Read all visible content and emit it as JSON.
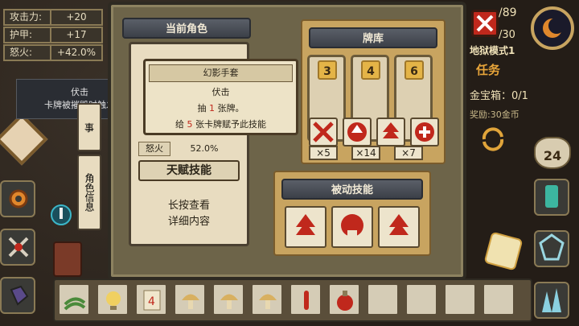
{
  "stats": [
    {
      "label": "攻击力:",
      "value": "+20"
    },
    {
      "label": "护甲:",
      "value": "+17"
    },
    {
      "label": "怒火:",
      "value": "+42.0%"
    }
  ],
  "left_tooltip": {
    "title": "伏击",
    "desc": "卡牌被摧毁时触发"
  },
  "char_panel": {
    "title": "当前角色",
    "fury_label": "怒火",
    "fury_value": "52.0%",
    "talent_label": "天赋技能",
    "hint_line1": "长按查看",
    "hint_line2": "详细内容",
    "side_tab_top": "事",
    "side_tab": "角色信息"
  },
  "gloves_tip": {
    "name": "幻影手套",
    "skill": "伏击",
    "line1_pre": "抽",
    "line1_num": "1",
    "line1_post": "张牌。",
    "line2_pre": "给",
    "line2_num": "5",
    "line2_post": "张卡牌赋予此技能"
  },
  "deck": {
    "title": "牌库",
    "cards": [
      {
        "num": "3"
      },
      {
        "num": "4"
      },
      {
        "num": "6"
      }
    ],
    "counts": [
      "×5",
      "×14",
      "×7"
    ]
  },
  "passive": {
    "title": "被动技能"
  },
  "hud": {
    "hp": "/89",
    "shield": "/30",
    "mode": "地狱模式1",
    "task": "任务",
    "chest": "金宝箱：0/1",
    "reward": "奖励:30金币",
    "gold": "24"
  },
  "colors": {
    "accent": "#c8a460",
    "red": "#c0281c",
    "panel": "#e8dcc0"
  }
}
